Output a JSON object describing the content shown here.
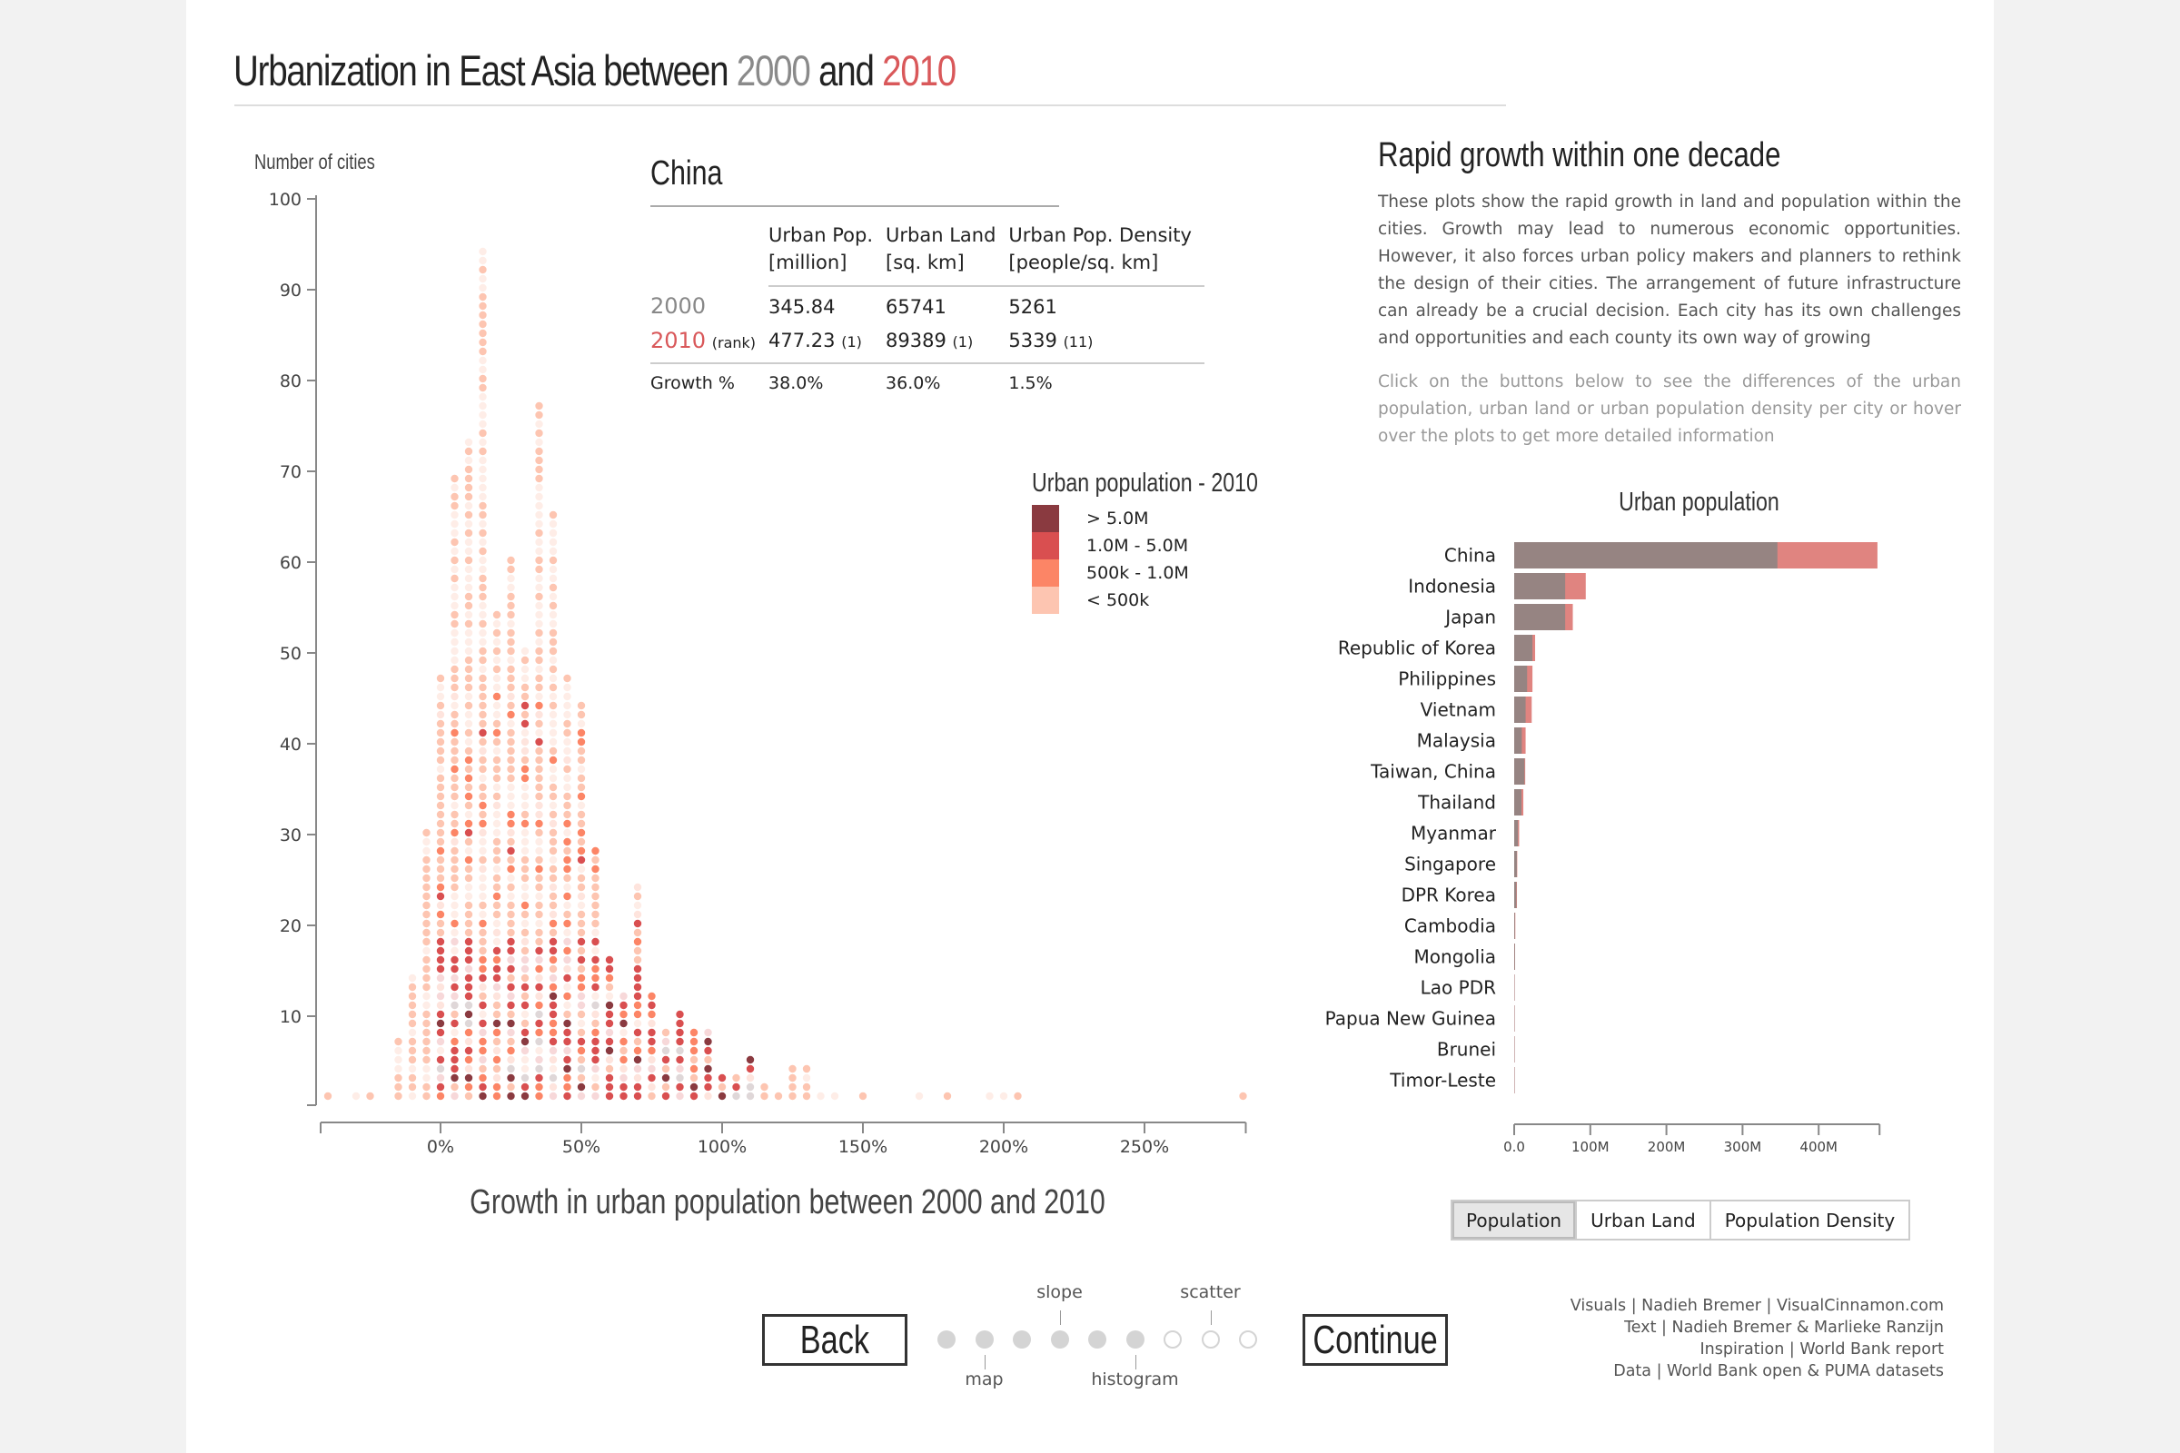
{
  "header": {
    "title_prefix": "Urbanization in East Asia between ",
    "year_a": "2000",
    "title_mid": " and ",
    "year_b": "2010"
  },
  "country_panel": {
    "name": "China",
    "columns": [
      "Urban Pop.",
      "Urban Land",
      "Urban Pop. Density"
    ],
    "units": [
      "[million]",
      "[sq. km]",
      "[people/sq. km]"
    ],
    "rows": {
      "y2000": {
        "label": "2000",
        "values": [
          "345.84",
          "65741",
          "5261"
        ]
      },
      "y2010": {
        "label": "2010",
        "rank_label": "(rank)",
        "values": [
          "477.23",
          "89389",
          "5339"
        ],
        "ranks": [
          "(1)",
          "(1)",
          "(11)"
        ]
      },
      "growth": {
        "label": "Growth %",
        "values": [
          "38.0%",
          "36.0%",
          "1.5%"
        ]
      }
    }
  },
  "legend": {
    "title": "Urban population - 2010",
    "items": [
      {
        "label": "> 5.0M",
        "color": "#8a3a40"
      },
      {
        "label": "1.0M - 5.0M",
        "color": "#d94f50"
      },
      {
        "label": "500k - 1.0M",
        "color": "#fc8566"
      },
      {
        "label": "< 500k",
        "color": "#fdc5b1"
      }
    ]
  },
  "side": {
    "title": "Rapid growth within one decade",
    "paragraph": "These plots show the rapid growth in land and population within the cities. Growth may lead to numerous economic opportunities. However, it also forces urban policy makers and planners to rethink the design of their cities. The arrangement of future infrastructure can already be a crucial decision. Each city has its own challenges and opportunities and each county its own way of growing",
    "hint": "Click on the buttons below to see the differences of the urban population, urban land or urban population density per city or hover over the plots to get more detailed information"
  },
  "metric_buttons": [
    {
      "label": "Population",
      "active": true
    },
    {
      "label": "Urban Land",
      "active": false
    },
    {
      "label": "Population Density",
      "active": false
    }
  ],
  "navigation": {
    "back": "Back",
    "continue": "Continue",
    "steps": [
      {
        "done": true,
        "label": "",
        "label_pos": ""
      },
      {
        "done": true,
        "label": "map",
        "label_pos": "below"
      },
      {
        "done": true,
        "label": "",
        "label_pos": ""
      },
      {
        "done": true,
        "label": "slope",
        "label_pos": "above"
      },
      {
        "done": true,
        "label": "",
        "label_pos": ""
      },
      {
        "done": true,
        "label": "histogram",
        "label_pos": "below"
      },
      {
        "done": false,
        "label": "",
        "label_pos": ""
      },
      {
        "done": false,
        "label": "scatter",
        "label_pos": "above"
      },
      {
        "done": false,
        "label": "",
        "label_pos": ""
      }
    ]
  },
  "credits": [
    "Visuals | Nadieh Bremer | VisualCinnamon.com",
    "Text | Nadieh Bremer & Marlieke Ranzijn",
    "Inspiration | World Bank report",
    "Data | World Bank open & PUMA datasets"
  ],
  "chart_data": [
    {
      "type": "scatter",
      "subtype": "dot-histogram",
      "title": "",
      "xlabel": "Growth in urban population between 2000 and 2010",
      "ylabel": "Number of cities",
      "xlim": [
        -40,
        285
      ],
      "ylim": [
        0,
        100
      ],
      "x_ticks": [
        "0%",
        "50%",
        "100%",
        "150%",
        "200%",
        "250%"
      ],
      "x_tick_values": [
        0,
        50,
        100,
        150,
        200,
        250
      ],
      "y_ticks": [
        10,
        20,
        30,
        40,
        50,
        60,
        70,
        80,
        90,
        100
      ],
      "bin_width_pct": 5,
      "highlighted_country": "China",
      "bins": [
        {
          "x": -40,
          "count": 1
        },
        {
          "x": -30,
          "count": 1
        },
        {
          "x": -25,
          "count": 1
        },
        {
          "x": -15,
          "count": 7
        },
        {
          "x": -10,
          "count": 14
        },
        {
          "x": -5,
          "count": 30
        },
        {
          "x": 0,
          "count": 47
        },
        {
          "x": 5,
          "count": 69
        },
        {
          "x": 10,
          "count": 73
        },
        {
          "x": 15,
          "count": 94
        },
        {
          "x": 20,
          "count": 54
        },
        {
          "x": 25,
          "count": 60
        },
        {
          "x": 30,
          "count": 50
        },
        {
          "x": 35,
          "count": 77
        },
        {
          "x": 40,
          "count": 65
        },
        {
          "x": 45,
          "count": 47
        },
        {
          "x": 50,
          "count": 44
        },
        {
          "x": 55,
          "count": 28
        },
        {
          "x": 60,
          "count": 16
        },
        {
          "x": 65,
          "count": 12
        },
        {
          "x": 70,
          "count": 24
        },
        {
          "x": 75,
          "count": 12
        },
        {
          "x": 80,
          "count": 8
        },
        {
          "x": 85,
          "count": 10
        },
        {
          "x": 90,
          "count": 8
        },
        {
          "x": 95,
          "count": 8
        },
        {
          "x": 100,
          "count": 3
        },
        {
          "x": 105,
          "count": 3
        },
        {
          "x": 110,
          "count": 5
        },
        {
          "x": 115,
          "count": 2
        },
        {
          "x": 120,
          "count": 1
        },
        {
          "x": 125,
          "count": 4
        },
        {
          "x": 130,
          "count": 4
        },
        {
          "x": 135,
          "count": 1
        },
        {
          "x": 140,
          "count": 1
        },
        {
          "x": 150,
          "count": 1
        },
        {
          "x": 170,
          "count": 1
        },
        {
          "x": 180,
          "count": 1
        },
        {
          "x": 195,
          "count": 1
        },
        {
          "x": 200,
          "count": 1
        },
        {
          "x": 205,
          "count": 1
        },
        {
          "x": 285,
          "count": 1
        }
      ],
      "color_categories": [
        "> 5.0M",
        "1.0M - 5.0M",
        "500k - 1.0M",
        "< 500k"
      ]
    },
    {
      "type": "bar",
      "orientation": "horizontal",
      "title": "Urban population",
      "xlabel": "",
      "ylabel": "",
      "xlim": [
        0,
        480
      ],
      "x_ticks": [
        "0.0",
        "100M",
        "200M",
        "300M",
        "400M"
      ],
      "x_tick_values": [
        0,
        100,
        200,
        300,
        400
      ],
      "units": "million",
      "categories": [
        "China",
        "Indonesia",
        "Japan",
        "Republic of Korea",
        "Philippines",
        "Vietnam",
        "Malaysia",
        "Taiwan, China",
        "Thailand",
        "Myanmar",
        "Singapore",
        "DPR Korea",
        "Cambodia",
        "Mongolia",
        "Lao PDR",
        "Papua New Guinea",
        "Brunei",
        "Timor-Leste"
      ],
      "series": [
        {
          "name": "2000",
          "color": "#968482",
          "values": [
            345.84,
            67,
            67,
            24,
            17,
            15,
            10,
            13.5,
            9.5,
            5,
            3.5,
            3,
            1,
            1,
            0.4,
            0.3,
            0.2,
            0.2
          ]
        },
        {
          "name": "2010",
          "color": "#e08480",
          "values": [
            477.23,
            94,
            77,
            27.5,
            24,
            23,
            15,
            14.5,
            12,
            6.5,
            4,
            3.6,
            1.5,
            1.2,
            0.6,
            0.4,
            0.3,
            0.3
          ]
        }
      ]
    }
  ]
}
